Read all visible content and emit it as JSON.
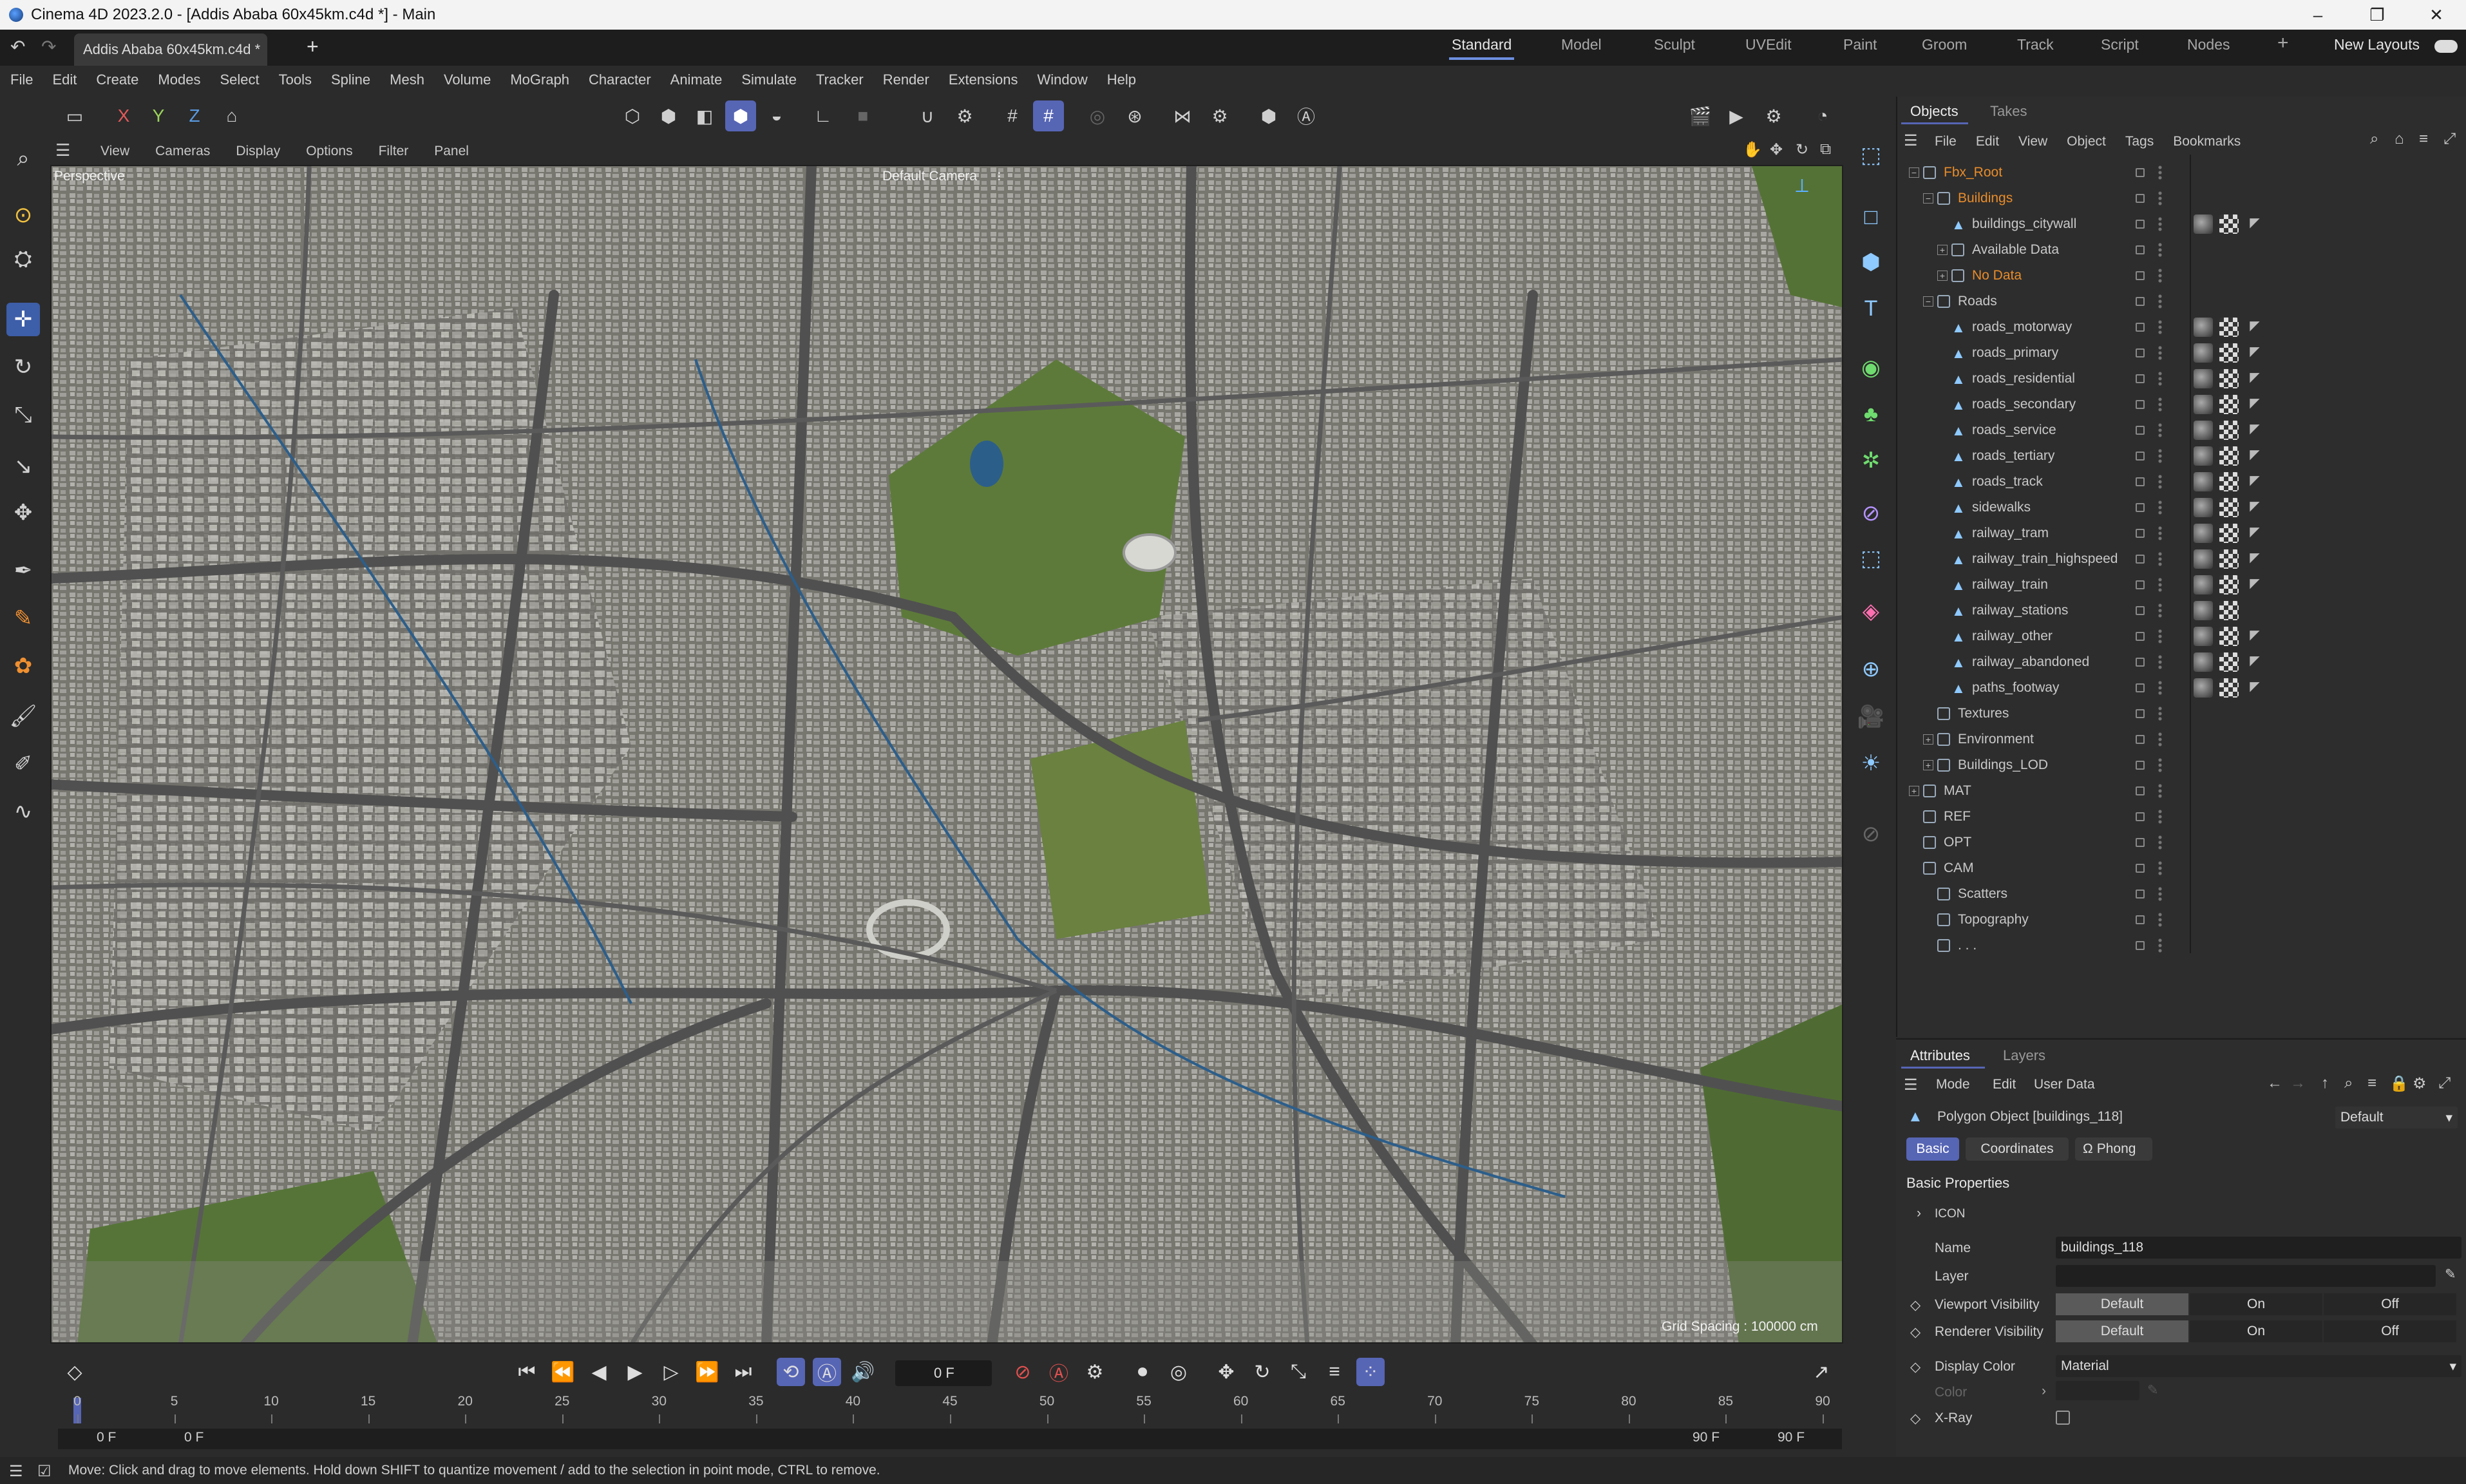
{
  "window": {
    "title": "Cinema 4D 2023.2.0 - [Addis Ababa 60x45km.c4d *] - Main",
    "minimize": "–",
    "maximize": "❐",
    "close": "✕"
  },
  "tabs": {
    "document": "Addis Ababa 60x45km.c4d *",
    "add": "+",
    "undo": "↶",
    "redo": "↷"
  },
  "layouts": {
    "items": [
      "Standard",
      "Model",
      "Sculpt",
      "UVEdit",
      "Paint",
      "Groom",
      "Track",
      "Script",
      "Nodes"
    ],
    "add": "+",
    "new_layouts": "New Layouts"
  },
  "menubar": [
    "File",
    "Edit",
    "Create",
    "Modes",
    "Select",
    "Tools",
    "Spline",
    "Mesh",
    "Volume",
    "MoGraph",
    "Character",
    "Animate",
    "Simulate",
    "Tracker",
    "Render",
    "Extensions",
    "Window",
    "Help"
  ],
  "toolbar": {
    "x": "X",
    "y": "Y",
    "z": "Z"
  },
  "viewport": {
    "menu": [
      "View",
      "Cameras",
      "Display",
      "Options",
      "Filter",
      "Panel"
    ],
    "label": "Perspective",
    "camera": "Default Camera",
    "camera_icon": "⁝",
    "grid_spacing": "Grid Spacing : 100000 cm"
  },
  "timeline": {
    "current_frame": "0 F",
    "ticks": [
      "0",
      "5",
      "10",
      "15",
      "20",
      "25",
      "30",
      "35",
      "40",
      "45",
      "50",
      "55",
      "60",
      "65",
      "70",
      "75",
      "80",
      "85",
      "90"
    ],
    "range_start": "0 F",
    "range_start2": "0 F",
    "range_end": "90 F",
    "range_end2": "90 F"
  },
  "status": "Move: Click and drag to move elements. Hold down SHIFT to quantize movement / add to the selection in point mode, CTRL to remove.",
  "objects_panel": {
    "tabs": [
      "Objects",
      "Takes"
    ],
    "menu": [
      "File",
      "Edit",
      "View",
      "Object",
      "Tags",
      "Bookmarks"
    ],
    "rows": [
      {
        "name": "Fbx_Root",
        "level": 0,
        "kind": "null",
        "orange": true,
        "expand": "−",
        "tags": 0
      },
      {
        "name": "Buildings",
        "level": 1,
        "kind": "null",
        "orange": true,
        "expand": "−",
        "tags": 0
      },
      {
        "name": "buildings_citywall",
        "level": 2,
        "kind": "poly",
        "orange": false,
        "expand": "",
        "tags": 3
      },
      {
        "name": "Available Data",
        "level": 2,
        "kind": "null",
        "orange": false,
        "expand": "+",
        "tags": 0
      },
      {
        "name": "No Data",
        "level": 2,
        "kind": "null",
        "orange": true,
        "expand": "+",
        "tags": 0
      },
      {
        "name": "Roads",
        "level": 1,
        "kind": "null",
        "orange": false,
        "expand": "−",
        "tags": 0
      },
      {
        "name": "roads_motorway",
        "level": 2,
        "kind": "poly",
        "orange": false,
        "expand": "",
        "tags": 3
      },
      {
        "name": "roads_primary",
        "level": 2,
        "kind": "poly",
        "orange": false,
        "expand": "",
        "tags": 3
      },
      {
        "name": "roads_residential",
        "level": 2,
        "kind": "poly",
        "orange": false,
        "expand": "",
        "tags": 3
      },
      {
        "name": "roads_secondary",
        "level": 2,
        "kind": "poly",
        "orange": false,
        "expand": "",
        "tags": 3
      },
      {
        "name": "roads_service",
        "level": 2,
        "kind": "poly",
        "orange": false,
        "expand": "",
        "tags": 3
      },
      {
        "name": "roads_tertiary",
        "level": 2,
        "kind": "poly",
        "orange": false,
        "expand": "",
        "tags": 3
      },
      {
        "name": "roads_track",
        "level": 2,
        "kind": "poly",
        "orange": false,
        "expand": "",
        "tags": 3
      },
      {
        "name": "sidewalks",
        "level": 2,
        "kind": "poly",
        "orange": false,
        "expand": "",
        "tags": 3
      },
      {
        "name": "railway_tram",
        "level": 2,
        "kind": "poly",
        "orange": false,
        "expand": "",
        "tags": 3
      },
      {
        "name": "railway_train_highspeed",
        "level": 2,
        "kind": "poly",
        "orange": false,
        "expand": "",
        "tags": 3
      },
      {
        "name": "railway_train",
        "level": 2,
        "kind": "poly",
        "orange": false,
        "expand": "",
        "tags": 3
      },
      {
        "name": "railway_stations",
        "level": 2,
        "kind": "poly",
        "orange": false,
        "expand": "",
        "tags": 2
      },
      {
        "name": "railway_other",
        "level": 2,
        "kind": "poly",
        "orange": false,
        "expand": "",
        "tags": 3
      },
      {
        "name": "railway_abandoned",
        "level": 2,
        "kind": "poly",
        "orange": false,
        "expand": "",
        "tags": 3
      },
      {
        "name": "paths_footway",
        "level": 2,
        "kind": "poly",
        "orange": false,
        "expand": "",
        "tags": 3
      },
      {
        "name": "Textures",
        "level": 1,
        "kind": "null",
        "orange": false,
        "expand": "",
        "tags": 0
      },
      {
        "name": "Environment",
        "level": 1,
        "kind": "null",
        "orange": false,
        "expand": "+",
        "tags": 0
      },
      {
        "name": "Buildings_LOD",
        "level": 1,
        "kind": "null",
        "orange": false,
        "expand": "+",
        "tags": 0
      },
      {
        "name": "MAT",
        "level": 0,
        "kind": "null",
        "orange": false,
        "expand": "+",
        "tags": 0
      },
      {
        "name": "REF",
        "level": 0,
        "kind": "null",
        "orange": false,
        "expand": "",
        "tags": 0
      },
      {
        "name": "OPT",
        "level": 0,
        "kind": "null",
        "orange": false,
        "expand": "",
        "tags": 0
      },
      {
        "name": "CAM",
        "level": 0,
        "kind": "null",
        "orange": false,
        "expand": "",
        "tags": 0
      },
      {
        "name": "Scatters",
        "level": 1,
        "kind": "null",
        "orange": false,
        "expand": "",
        "tags": 0
      },
      {
        "name": "Topography",
        "level": 1,
        "kind": "null",
        "orange": false,
        "expand": "",
        "tags": 0
      },
      {
        "name": ". . .",
        "level": 1,
        "kind": "null",
        "orange": false,
        "expand": "",
        "tags": 0
      }
    ]
  },
  "attributes": {
    "tabs": [
      "Attributes",
      "Layers"
    ],
    "menu": [
      "Mode",
      "Edit",
      "User Data"
    ],
    "object_title": "Polygon Object [buildings_118]",
    "preset": "Default",
    "sub_tabs": [
      "Basic",
      "Coordinates",
      "Phong"
    ],
    "phong_symbol": "Ω",
    "section": "Basic Properties",
    "icon_group": "ICON",
    "name_label": "Name",
    "name_value": "buildings_118",
    "layer_label": "Layer",
    "viewport_vis_label": "Viewport Visibility",
    "renderer_vis_label": "Renderer Visibility",
    "vis_options": [
      "Default",
      "On",
      "Off"
    ],
    "display_color_label": "Display Color",
    "display_color_value": "Material",
    "color_label": "Color",
    "xray_label": "X-Ray"
  },
  "colors": {
    "accent": "#5765b5",
    "orange": "#e88c2a",
    "viewport_ground": "#7b7a75",
    "park": "#5d7a3a",
    "water": "#2c5e8a"
  }
}
